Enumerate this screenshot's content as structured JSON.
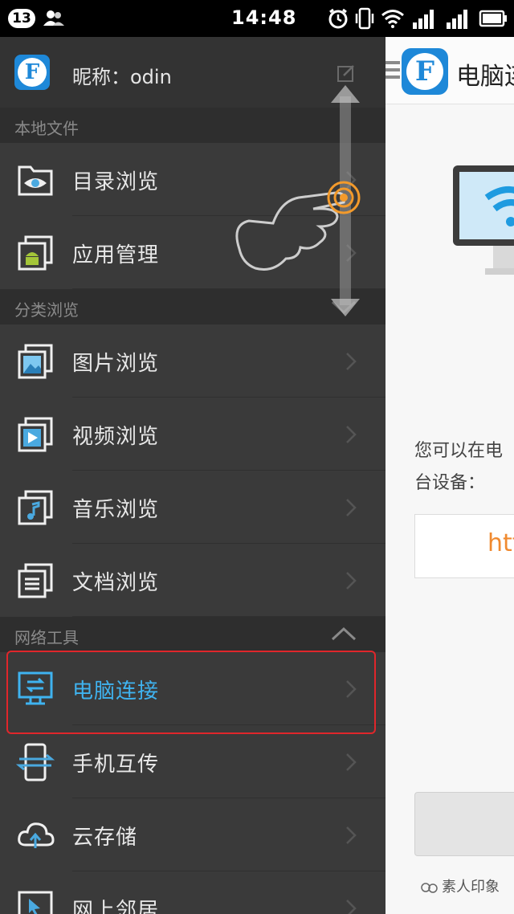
{
  "status_bar": {
    "notification_count": "13",
    "time": "14:48"
  },
  "drawer": {
    "profile": {
      "name": "昵称：odin"
    },
    "sections": [
      {
        "label": "本地文件",
        "items": [
          {
            "label": "目录浏览",
            "icon": "folder-eye-icon"
          },
          {
            "label": "应用管理",
            "icon": "android-app-icon"
          }
        ]
      },
      {
        "label": "分类浏览",
        "items": [
          {
            "label": "图片浏览",
            "icon": "image-icon"
          },
          {
            "label": "视频浏览",
            "icon": "video-icon"
          },
          {
            "label": "音乐浏览",
            "icon": "music-icon"
          },
          {
            "label": "文档浏览",
            "icon": "document-icon"
          }
        ]
      },
      {
        "label": "网络工具",
        "items": [
          {
            "label": "电脑连接",
            "icon": "pc-connect-icon",
            "active": true
          },
          {
            "label": "手机互传",
            "icon": "phone-transfer-icon"
          },
          {
            "label": "云存储",
            "icon": "cloud-upload-icon"
          },
          {
            "label": "网上邻居",
            "icon": "network-neighbor-icon"
          }
        ]
      }
    ]
  },
  "content": {
    "title": "电脑连",
    "description_line1": "您可以在电",
    "description_line2": "台设备：",
    "url_fragment": "htt"
  },
  "watermark": "素人印象",
  "colors": {
    "drawer_bg": "#3a3a3a",
    "section_bg": "#2e2e2e",
    "active_text": "#3fb3f0",
    "highlight_border": "#e0262b",
    "brand_blue": "#1e88d8",
    "url_orange": "#f08a30",
    "gesture_orange": "#f39a2b"
  }
}
